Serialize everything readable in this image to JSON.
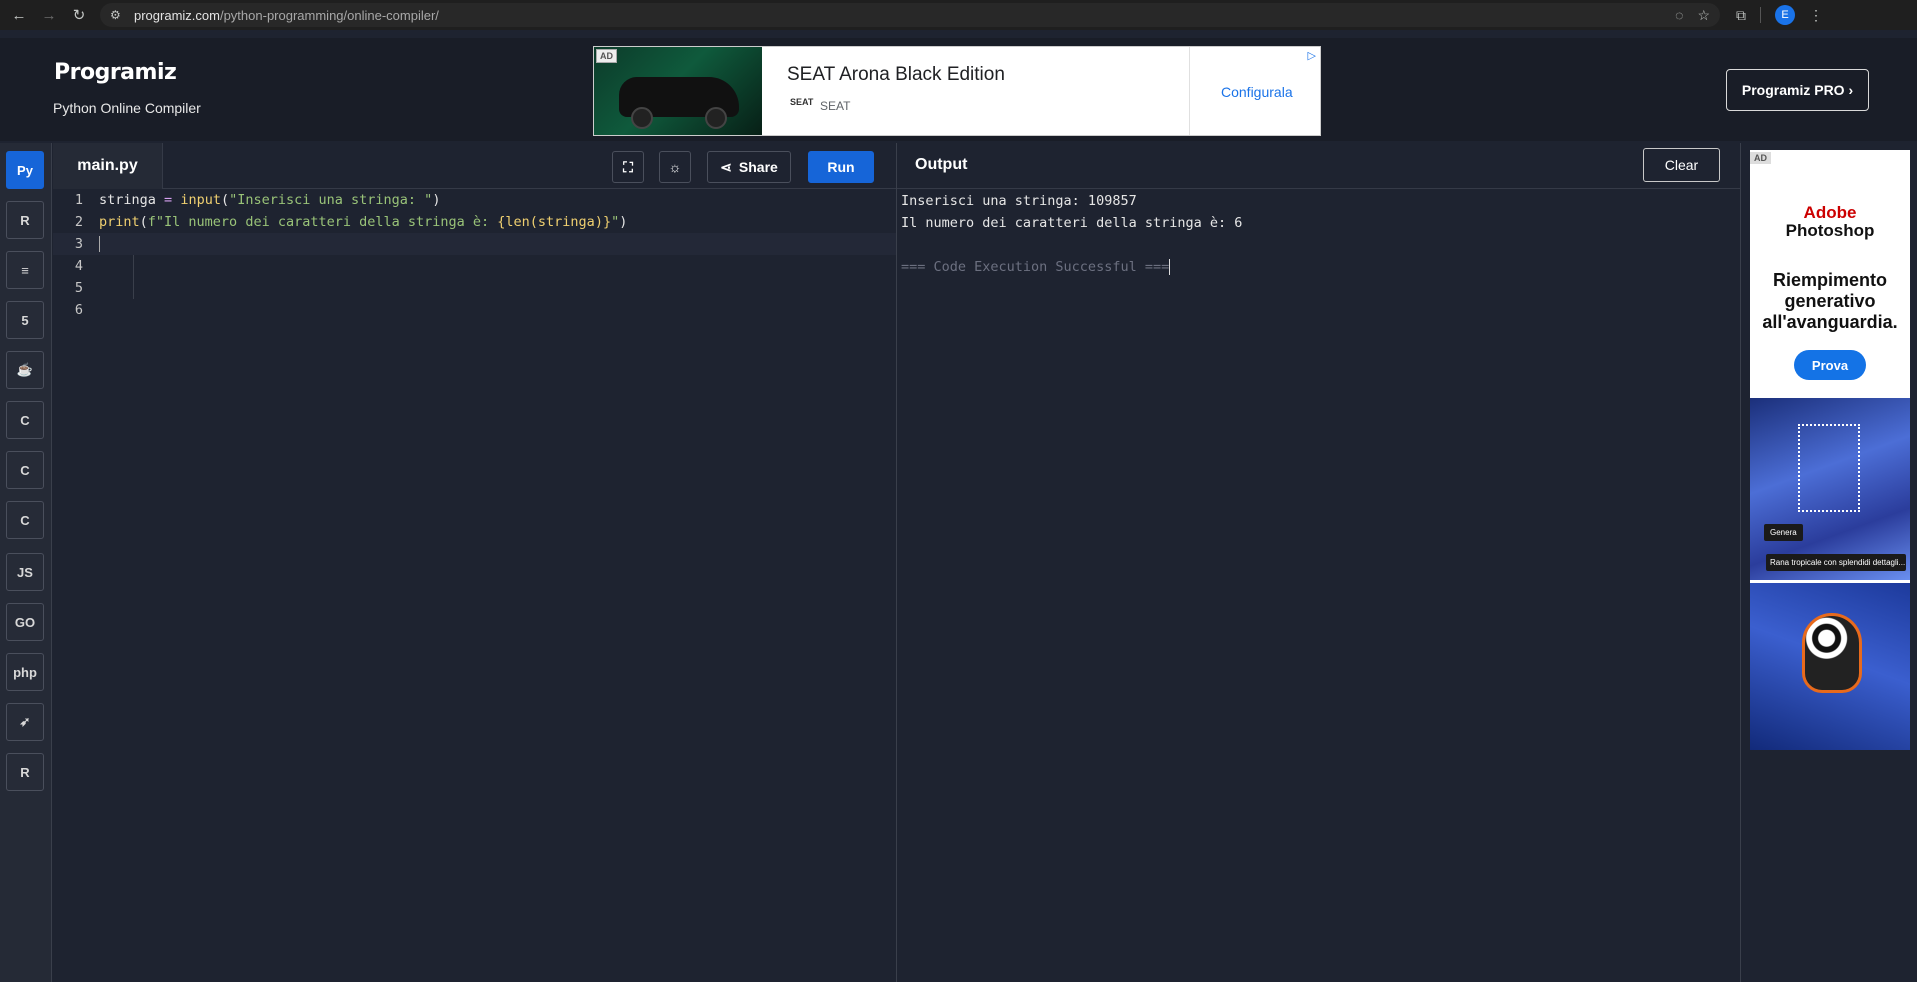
{
  "browser": {
    "url_host": "programiz.com",
    "url_path": "/python-programming/online-compiler/",
    "profile_initial": "E"
  },
  "header": {
    "logo": "Programiz",
    "subtitle": "Python Online Compiler",
    "pro_button": "Programiz PRO ›"
  },
  "top_ad": {
    "tag": "AD",
    "title": "SEAT Arona Black Edition",
    "brand_logo": "SEAT",
    "brand": "SEAT",
    "cta": "Configurala"
  },
  "sidebar": {
    "items": [
      {
        "name": "python",
        "label": "Py",
        "active": true
      },
      {
        "name": "r",
        "label": "R"
      },
      {
        "name": "sql",
        "label": "≡"
      },
      {
        "name": "html",
        "label": "5"
      },
      {
        "name": "java",
        "label": "☕"
      },
      {
        "name": "c",
        "label": "C"
      },
      {
        "name": "cpp",
        "label": "C"
      },
      {
        "name": "csharp",
        "label": "C"
      },
      {
        "name": "js",
        "label": "JS"
      },
      {
        "name": "go",
        "label": "GO"
      },
      {
        "name": "php",
        "label": "php"
      },
      {
        "name": "swift",
        "label": "➶"
      },
      {
        "name": "rust",
        "label": "R"
      }
    ]
  },
  "editor": {
    "file_name": "main.py",
    "share_label": "Share",
    "run_label": "Run",
    "line_numbers": [
      "1",
      "2",
      "3",
      "4",
      "5",
      "6"
    ],
    "line1": {
      "var": "stringa",
      "op": "=",
      "fn": "input",
      "str": "\"Inserisci una stringa: \""
    },
    "line2": {
      "fn": "print",
      "str_open": "f\"Il numero dei caratteri della stringa è: ",
      "expr": "{len(stringa)}",
      "str_close": "\""
    }
  },
  "output": {
    "title": "Output",
    "clear_label": "Clear",
    "lines": [
      "Inserisci una stringa: 109857",
      "Il numero dei caratteri della stringa è: 6",
      "",
      "=== Code Execution Successful ==="
    ]
  },
  "side_ad": {
    "tag": "AD",
    "brand_line1": "Adobe",
    "brand_line2": "Photoshop",
    "headline": "Riempimento generativo all'avanguardia.",
    "cta": "Prova",
    "genera": "Genera",
    "caption": "Rana tropicale con splendidi dettagli..."
  }
}
